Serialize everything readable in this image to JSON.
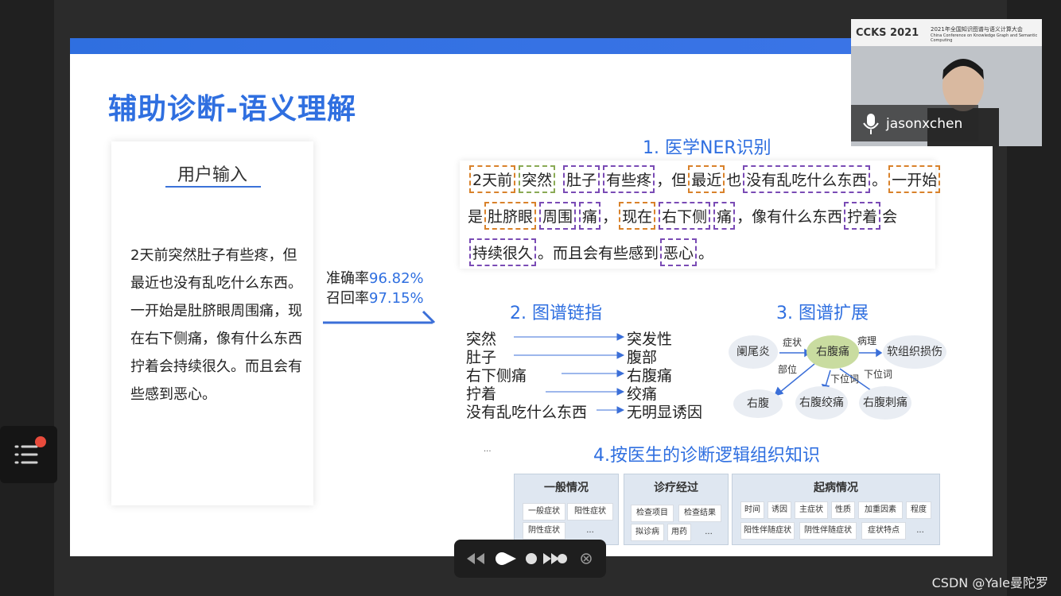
{
  "slide": {
    "title": "辅助诊断-语义理解",
    "user_input": {
      "heading": "用户输入",
      "text": "2天前突然肚子有些疼，但最近也没有乱吃什么东西。一开始是肚脐眼周围痛，现在右下侧痛，像有什么东西拧着会持续很久。而且会有些感到恶心。"
    },
    "metrics": {
      "precision_label": "准确率",
      "precision_value": "96.82%",
      "recall_label": "召回率",
      "recall_value": "97.15%"
    },
    "ner": {
      "heading": "1. 医学NER识别",
      "line1": [
        "2天前",
        "突然",
        "肚子",
        "有些疼",
        "，但",
        "最近",
        "也",
        "没有乱吃什么东西",
        "。",
        "一开始"
      ],
      "line2": [
        "是",
        "肚脐眼",
        "周围",
        "痛",
        "，",
        "现在",
        "右下侧",
        "痛",
        "，像有什么东西",
        "拧着",
        "会"
      ],
      "line3": [
        "持续很久",
        "。而且会有些感到",
        "恶心",
        "。"
      ]
    },
    "linking": {
      "heading": "2. 图谱链指",
      "pairs": [
        {
          "from": "突然",
          "to": "突发性"
        },
        {
          "from": "肚子",
          "to": "腹部"
        },
        {
          "from": "右下侧痛",
          "to": "右腹痛"
        },
        {
          "from": "拧着",
          "to": "绞痛"
        },
        {
          "from": "没有乱吃什么东西",
          "to": "无明显诱因"
        }
      ]
    },
    "expansion": {
      "heading": "3. 图谱扩展",
      "nodes": {
        "appendicitis": "阑尾炎",
        "right_abdominal_pain": "右腹痛",
        "soft_tissue_injury": "软组织损伤",
        "right_abdomen": "右腹",
        "right_abdominal_colic": "右腹绞痛",
        "right_abdominal_stabbing": "右腹刺痛"
      },
      "edges": {
        "symptom": "症状",
        "pathology": "病理",
        "location": "部位",
        "hyponym1": "下位词",
        "hyponym2": "下位词"
      }
    },
    "organize": {
      "heading": "4.按医生的诊断逻辑组织知识",
      "ellipsis_mark": "...",
      "groups": [
        {
          "title": "一般情况",
          "tags": [
            "一般症状",
            "阳性症状",
            "阴性症状",
            "..."
          ]
        },
        {
          "title": "诊疗经过",
          "tags": [
            "检查项目",
            "检查结果",
            "拟诊病",
            "用药",
            "..."
          ]
        },
        {
          "title": "起病情况",
          "tags": [
            "时间",
            "诱因",
            "主症状",
            "性质",
            "加重因素",
            "程度",
            "阳性伴随症状",
            "阴性伴随症状",
            "症状特点",
            "..."
          ]
        }
      ]
    }
  },
  "webcam": {
    "conference_logo": "CCKS 2021",
    "conference_title": "2021年全国知识图谱与语义计算大会",
    "conference_subtitle": "China Conference on Knowledge Graph and Semantic Computing",
    "participant_name": "jasonxchen",
    "mic_icon": "microphone-icon"
  },
  "controls": {
    "icons": [
      "rewind-icon",
      "play-icon",
      "progress-dot-icon",
      "forward-icon",
      "close-icon"
    ]
  },
  "sidebar_button": {
    "icon": "list-menu-icon",
    "badge_color": "#e84b3c"
  },
  "watermark": "CSDN @Yale曼陀罗"
}
